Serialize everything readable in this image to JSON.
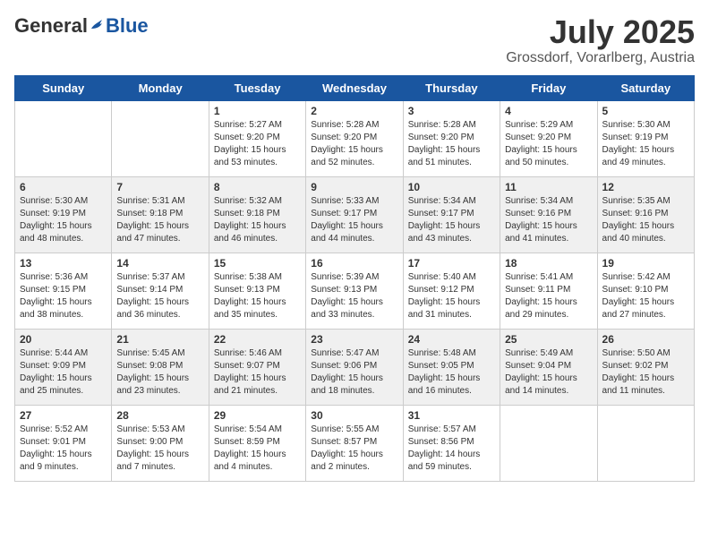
{
  "header": {
    "logo_general": "General",
    "logo_blue": "Blue",
    "month_year": "July 2025",
    "location": "Grossdorf, Vorarlberg, Austria"
  },
  "days_of_week": [
    "Sunday",
    "Monday",
    "Tuesday",
    "Wednesday",
    "Thursday",
    "Friday",
    "Saturday"
  ],
  "weeks": [
    [
      {
        "day": null
      },
      {
        "day": null
      },
      {
        "day": 1,
        "sunrise": "Sunrise: 5:27 AM",
        "sunset": "Sunset: 9:20 PM",
        "daylight": "Daylight: 15 hours and 53 minutes."
      },
      {
        "day": 2,
        "sunrise": "Sunrise: 5:28 AM",
        "sunset": "Sunset: 9:20 PM",
        "daylight": "Daylight: 15 hours and 52 minutes."
      },
      {
        "day": 3,
        "sunrise": "Sunrise: 5:28 AM",
        "sunset": "Sunset: 9:20 PM",
        "daylight": "Daylight: 15 hours and 51 minutes."
      },
      {
        "day": 4,
        "sunrise": "Sunrise: 5:29 AM",
        "sunset": "Sunset: 9:20 PM",
        "daylight": "Daylight: 15 hours and 50 minutes."
      },
      {
        "day": 5,
        "sunrise": "Sunrise: 5:30 AM",
        "sunset": "Sunset: 9:19 PM",
        "daylight": "Daylight: 15 hours and 49 minutes."
      }
    ],
    [
      {
        "day": 6,
        "sunrise": "Sunrise: 5:30 AM",
        "sunset": "Sunset: 9:19 PM",
        "daylight": "Daylight: 15 hours and 48 minutes."
      },
      {
        "day": 7,
        "sunrise": "Sunrise: 5:31 AM",
        "sunset": "Sunset: 9:18 PM",
        "daylight": "Daylight: 15 hours and 47 minutes."
      },
      {
        "day": 8,
        "sunrise": "Sunrise: 5:32 AM",
        "sunset": "Sunset: 9:18 PM",
        "daylight": "Daylight: 15 hours and 46 minutes."
      },
      {
        "day": 9,
        "sunrise": "Sunrise: 5:33 AM",
        "sunset": "Sunset: 9:17 PM",
        "daylight": "Daylight: 15 hours and 44 minutes."
      },
      {
        "day": 10,
        "sunrise": "Sunrise: 5:34 AM",
        "sunset": "Sunset: 9:17 PM",
        "daylight": "Daylight: 15 hours and 43 minutes."
      },
      {
        "day": 11,
        "sunrise": "Sunrise: 5:34 AM",
        "sunset": "Sunset: 9:16 PM",
        "daylight": "Daylight: 15 hours and 41 minutes."
      },
      {
        "day": 12,
        "sunrise": "Sunrise: 5:35 AM",
        "sunset": "Sunset: 9:16 PM",
        "daylight": "Daylight: 15 hours and 40 minutes."
      }
    ],
    [
      {
        "day": 13,
        "sunrise": "Sunrise: 5:36 AM",
        "sunset": "Sunset: 9:15 PM",
        "daylight": "Daylight: 15 hours and 38 minutes."
      },
      {
        "day": 14,
        "sunrise": "Sunrise: 5:37 AM",
        "sunset": "Sunset: 9:14 PM",
        "daylight": "Daylight: 15 hours and 36 minutes."
      },
      {
        "day": 15,
        "sunrise": "Sunrise: 5:38 AM",
        "sunset": "Sunset: 9:13 PM",
        "daylight": "Daylight: 15 hours and 35 minutes."
      },
      {
        "day": 16,
        "sunrise": "Sunrise: 5:39 AM",
        "sunset": "Sunset: 9:13 PM",
        "daylight": "Daylight: 15 hours and 33 minutes."
      },
      {
        "day": 17,
        "sunrise": "Sunrise: 5:40 AM",
        "sunset": "Sunset: 9:12 PM",
        "daylight": "Daylight: 15 hours and 31 minutes."
      },
      {
        "day": 18,
        "sunrise": "Sunrise: 5:41 AM",
        "sunset": "Sunset: 9:11 PM",
        "daylight": "Daylight: 15 hours and 29 minutes."
      },
      {
        "day": 19,
        "sunrise": "Sunrise: 5:42 AM",
        "sunset": "Sunset: 9:10 PM",
        "daylight": "Daylight: 15 hours and 27 minutes."
      }
    ],
    [
      {
        "day": 20,
        "sunrise": "Sunrise: 5:44 AM",
        "sunset": "Sunset: 9:09 PM",
        "daylight": "Daylight: 15 hours and 25 minutes."
      },
      {
        "day": 21,
        "sunrise": "Sunrise: 5:45 AM",
        "sunset": "Sunset: 9:08 PM",
        "daylight": "Daylight: 15 hours and 23 minutes."
      },
      {
        "day": 22,
        "sunrise": "Sunrise: 5:46 AM",
        "sunset": "Sunset: 9:07 PM",
        "daylight": "Daylight: 15 hours and 21 minutes."
      },
      {
        "day": 23,
        "sunrise": "Sunrise: 5:47 AM",
        "sunset": "Sunset: 9:06 PM",
        "daylight": "Daylight: 15 hours and 18 minutes."
      },
      {
        "day": 24,
        "sunrise": "Sunrise: 5:48 AM",
        "sunset": "Sunset: 9:05 PM",
        "daylight": "Daylight: 15 hours and 16 minutes."
      },
      {
        "day": 25,
        "sunrise": "Sunrise: 5:49 AM",
        "sunset": "Sunset: 9:04 PM",
        "daylight": "Daylight: 15 hours and 14 minutes."
      },
      {
        "day": 26,
        "sunrise": "Sunrise: 5:50 AM",
        "sunset": "Sunset: 9:02 PM",
        "daylight": "Daylight: 15 hours and 11 minutes."
      }
    ],
    [
      {
        "day": 27,
        "sunrise": "Sunrise: 5:52 AM",
        "sunset": "Sunset: 9:01 PM",
        "daylight": "Daylight: 15 hours and 9 minutes."
      },
      {
        "day": 28,
        "sunrise": "Sunrise: 5:53 AM",
        "sunset": "Sunset: 9:00 PM",
        "daylight": "Daylight: 15 hours and 7 minutes."
      },
      {
        "day": 29,
        "sunrise": "Sunrise: 5:54 AM",
        "sunset": "Sunset: 8:59 PM",
        "daylight": "Daylight: 15 hours and 4 minutes."
      },
      {
        "day": 30,
        "sunrise": "Sunrise: 5:55 AM",
        "sunset": "Sunset: 8:57 PM",
        "daylight": "Daylight: 15 hours and 2 minutes."
      },
      {
        "day": 31,
        "sunrise": "Sunrise: 5:57 AM",
        "sunset": "Sunset: 8:56 PM",
        "daylight": "Daylight: 14 hours and 59 minutes."
      },
      {
        "day": null
      },
      {
        "day": null
      }
    ]
  ]
}
